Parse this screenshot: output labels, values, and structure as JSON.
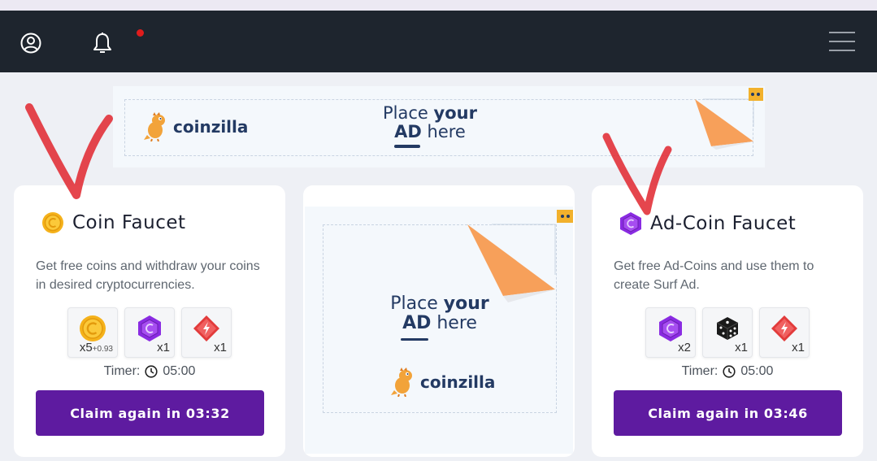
{
  "nav": {
    "icons": [
      "user-profile-icon",
      "bell-icon",
      "hamburger-menu-icon"
    ],
    "notification_dot_color": "#e01c1c"
  },
  "banner_ad": {
    "brand": "coinzilla",
    "line1_prefix": "Place ",
    "line1_bold": "your",
    "line2_bold": "AD",
    "line2_suffix": " here"
  },
  "coin_faucet": {
    "title": "Coin Faucet",
    "description": "Get free coins and withdraw your coins in desired cryptocurrencies.",
    "rewards": [
      {
        "icon": "gold-coin-icon",
        "qty": "x5",
        "bonus": "+0.93"
      },
      {
        "icon": "purple-hex-coin-icon",
        "qty": "x1",
        "bonus": ""
      },
      {
        "icon": "red-energy-gem-icon",
        "qty": "x1",
        "bonus": ""
      }
    ],
    "timer_label": "Timer:",
    "timer_value": "05:00",
    "button_label": "Claim again in 03:32"
  },
  "middle_ad": {
    "line1_prefix": "Place ",
    "line1_bold": "your",
    "line2_bold": "AD",
    "line2_suffix": " here",
    "brand": "coinzilla"
  },
  "adcoin_faucet": {
    "title": "Ad-Coin Faucet",
    "description": "Get free Ad-Coins and use them to create Surf Ad.",
    "rewards": [
      {
        "icon": "purple-hex-coin-icon",
        "qty": "x2"
      },
      {
        "icon": "dice-icon",
        "qty": "x1"
      },
      {
        "icon": "red-energy-gem-icon",
        "qty": "x1"
      }
    ],
    "timer_label": "Timer:",
    "timer_value": "05:00",
    "button_label": "Claim again in 03:46"
  },
  "colors": {
    "navbar": "#1e252e",
    "button": "#5e1ba0",
    "ad_text": "#233a63",
    "ad_peel": "#f7a05a",
    "checkmark": "#e0262e"
  }
}
